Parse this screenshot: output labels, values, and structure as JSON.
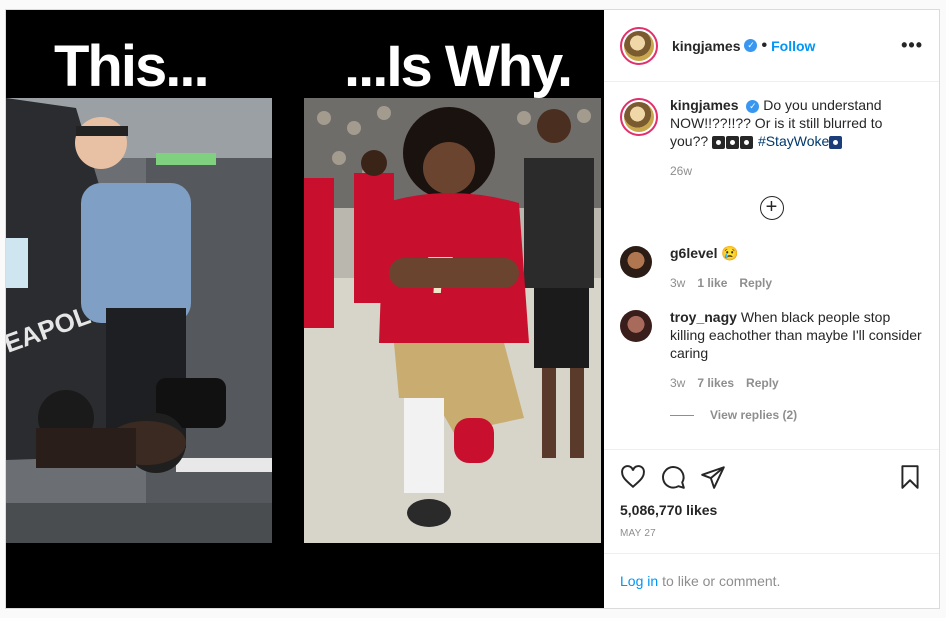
{
  "post": {
    "image": {
      "title_left": "This...",
      "title_right": "...Is Why."
    },
    "header": {
      "username": "kingjames",
      "follow_label": "Follow",
      "more_icon": "ellipsis-icon"
    },
    "caption": {
      "username": "kingjames",
      "text": "Do you understand NOW!!??!!?? Or is it still blurred to you??",
      "hashtag": "#StayWoke",
      "time": "26w"
    },
    "load_more_icon": "plus-circle-icon",
    "comments": [
      {
        "username": "g6level",
        "text": "😢",
        "time": "3w",
        "likes": "1 like",
        "reply_label": "Reply"
      },
      {
        "username": "troy_nagy",
        "text": "When black people stop killing eachother than maybe I'll consider caring",
        "time": "3w",
        "likes": "7 likes",
        "reply_label": "Reply"
      }
    ],
    "view_replies": "View replies (2)",
    "likes_count": "5,086,770 likes",
    "date": "MAY 27",
    "login_link": "Log in",
    "login_suffix": "to like or comment."
  },
  "colors": {
    "link_blue": "#0095f6",
    "verified_blue": "#3897f0",
    "story_ring": "#e1306c",
    "muted": "#8e8e8e"
  }
}
